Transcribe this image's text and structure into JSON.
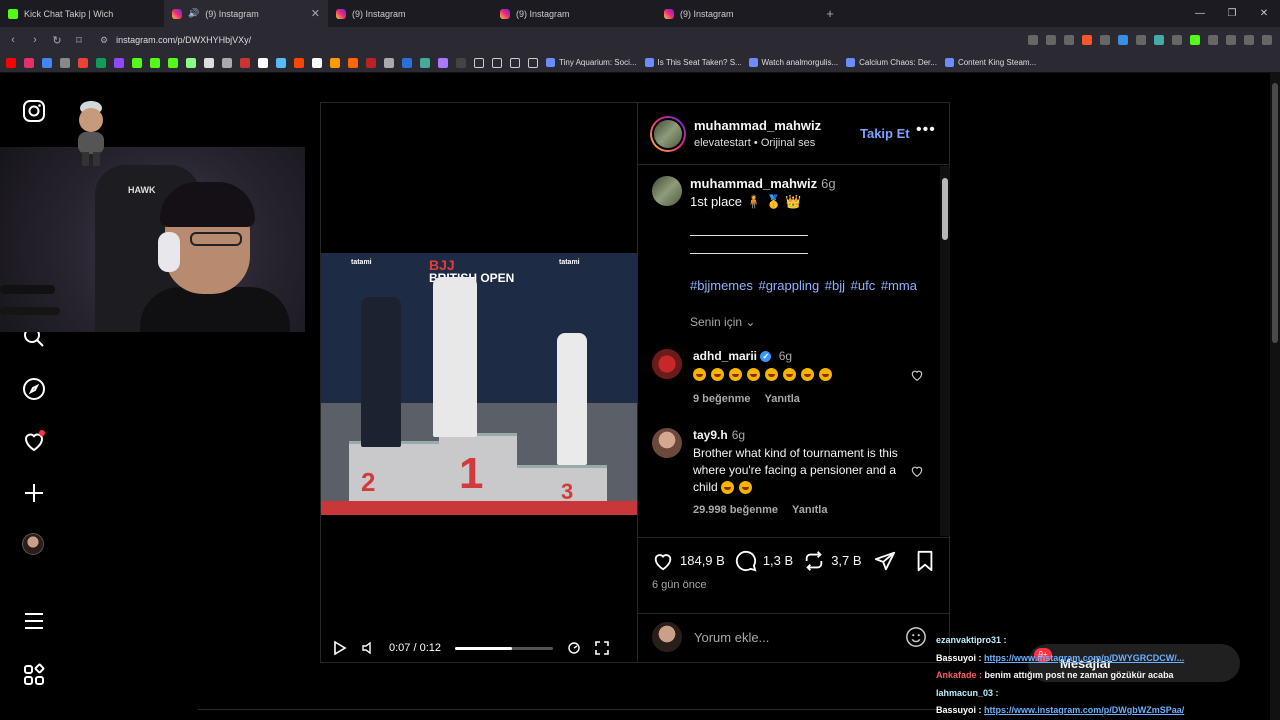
{
  "browser": {
    "tabs": [
      {
        "title": "Kick Chat Takip | Wich",
        "favicon": "kick"
      },
      {
        "title": "(9) Instagram",
        "favicon": "instagram",
        "active": true,
        "audio": true
      },
      {
        "title": "(9) Instagram",
        "favicon": "instagram"
      },
      {
        "title": "(9) Instagram",
        "favicon": "instagram"
      },
      {
        "title": "(9) Instagram",
        "favicon": "instagram"
      }
    ],
    "url": "instagram.com/p/DWXHYHbjVXy/",
    "bookmarks": [
      "Tiny Aquarium: Soci...",
      "Is This Seat Taken? S...",
      "Watch analmorgulis...",
      "Calcium Chaos: Der...",
      "Content King Steam..."
    ]
  },
  "post": {
    "author": "muhammad_mahwiz",
    "audio": "elevatestart • Orijinal ses",
    "follow_label": "Takip Et",
    "caption_time": "6g",
    "caption_text": "1st place",
    "hashtags": "#bjjmemes #grappling #bjj #ufc #mma",
    "for_you": "Senin için",
    "banner_title": "BRITISH OPEN",
    "banner_top": "BJJ",
    "sponsor": "tatami",
    "podium_numbers": [
      "2",
      "1",
      "3"
    ],
    "video_time": "0:07 / 0:12",
    "video_progress": 0.58,
    "comments": [
      {
        "user": "adhd_marii",
        "verified": true,
        "time": "6g",
        "emoji_count": 8,
        "likes": "9 beğenme",
        "reply": "Yanıtla"
      },
      {
        "user": "tay9.h",
        "verified": false,
        "time": "6g",
        "text": "Brother what kind of tournament is this where you're facing a pensioner and a child",
        "likes": "29.998 beğenme",
        "reply": "Yanıtla"
      }
    ],
    "like_count": "184,9 B",
    "comment_count": "1,3 B",
    "repost_count": "3,7 B",
    "date": "6 gün önce",
    "add_comment_placeholder": "Yorum ekle..."
  },
  "overlay": {
    "chat": [
      {
        "user": "ezanvaktipro31 :",
        "text": "",
        "color": "u1"
      },
      {
        "user": "Bassuyoi :",
        "text": "https://www.instagram.com/p/DWYGRCDCW/...",
        "link": true,
        "color": "u2"
      },
      {
        "user": "Ankafade :",
        "text": "benim attığım post ne zaman gözükür acaba",
        "color": "u3"
      },
      {
        "user": "lahmacun_03 :",
        "text": "",
        "color": "u1"
      },
      {
        "user": "Bassuyoi :",
        "text": "https://www.instagram.com/p/DWgbWZmSPaa/",
        "link": true,
        "color": "u2"
      }
    ],
    "messages_label": "Mesajlar",
    "messages_badge": "9+"
  },
  "webcam_logo": "HAWK"
}
